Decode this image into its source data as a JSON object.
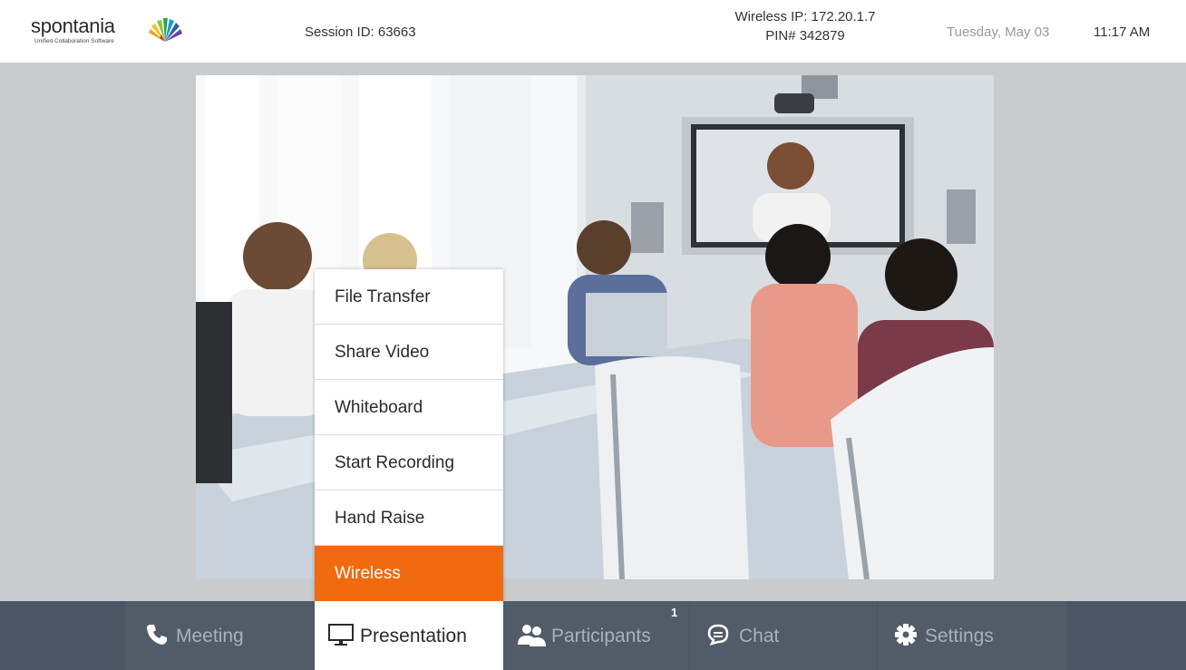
{
  "header": {
    "logo_text": "spontania",
    "logo_subtitle": "Unified Collaboration Software",
    "session_id": "Session ID: 63663",
    "wireless_ip": "Wireless IP: 172.20.1.7",
    "pin": "PIN# 342879",
    "date": "Tuesday, May 03",
    "time": "11:17 AM"
  },
  "menu": {
    "items": [
      {
        "label": "File Transfer"
      },
      {
        "label": "Share Video"
      },
      {
        "label": "Whiteboard"
      },
      {
        "label": "Start Recording"
      },
      {
        "label": "Hand Raise"
      },
      {
        "label": "Wireless"
      }
    ],
    "active_color": "#f06a0f"
  },
  "toolbar": {
    "meeting": "Meeting",
    "presentation": "Presentation",
    "participants": "Participants",
    "participants_count": "1",
    "chat": "Chat",
    "settings": "Settings"
  },
  "icons": {
    "meeting": "phone-icon",
    "presentation": "monitor-icon",
    "participants": "people-icon",
    "chat": "chat-bubble-icon",
    "settings": "gear-icon"
  },
  "colors": {
    "toolbar_bg": "#4b5563",
    "accent_orange": "#f06a0f",
    "stage_bg": "#c9cbcd"
  }
}
